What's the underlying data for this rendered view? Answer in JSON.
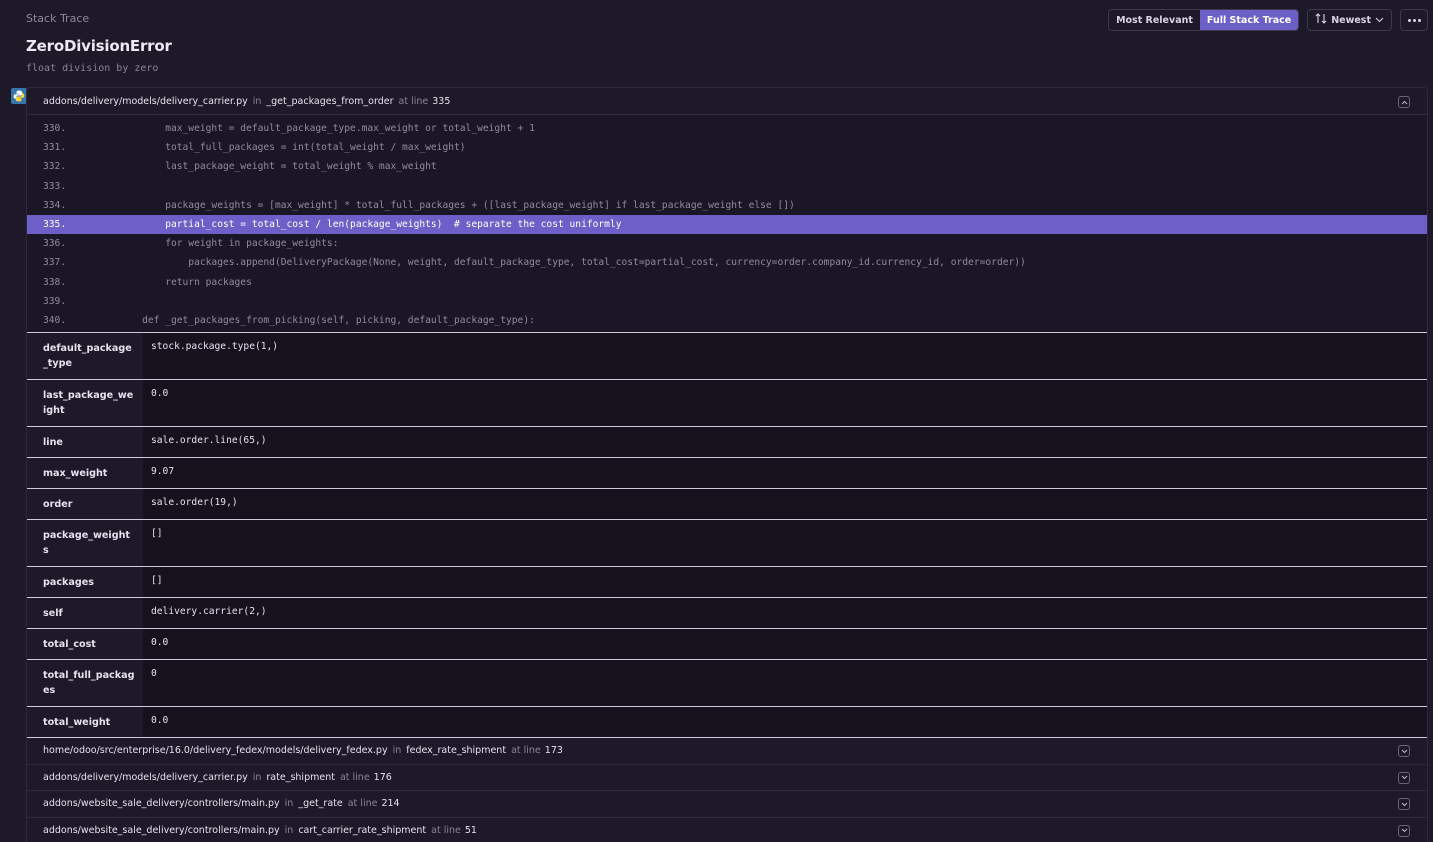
{
  "header": {
    "section_label": "Stack Trace",
    "exception_type": "ZeroDivisionError",
    "exception_message": "float division by zero"
  },
  "controls": {
    "most_relevant": "Most Relevant",
    "full_stack_trace": "Full Stack Trace",
    "sort_label": "Newest",
    "active_view": "Full Stack Trace"
  },
  "platform_icon": "python-icon",
  "expanded_frame": {
    "file": "addons/delivery/models/delivery_carrier.py",
    "in_word": "in",
    "function": "_get_packages_from_order",
    "at_line_word": "at line",
    "line": "335",
    "code": [
      {
        "num": "330.",
        "text": "        max_weight = default_package_type.max_weight or total_weight + 1"
      },
      {
        "num": "331.",
        "text": "        total_full_packages = int(total_weight / max_weight)"
      },
      {
        "num": "332.",
        "text": "        last_package_weight = total_weight % max_weight"
      },
      {
        "num": "333.",
        "text": ""
      },
      {
        "num": "334.",
        "text": "        package_weights = [max_weight] * total_full_packages + ([last_package_weight] if last_package_weight else [])"
      },
      {
        "num": "335.",
        "text": "        partial_cost = total_cost / len(package_weights)  # separate the cost uniformly"
      },
      {
        "num": "336.",
        "text": "        for weight in package_weights:"
      },
      {
        "num": "337.",
        "text": "            packages.append(DeliveryPackage(None, weight, default_package_type, total_cost=partial_cost, currency=order.company_id.currency_id, order=order))"
      },
      {
        "num": "338.",
        "text": "        return packages"
      },
      {
        "num": "339.",
        "text": ""
      },
      {
        "num": "340.",
        "text": "    def _get_packages_from_picking(self, picking, default_package_type):"
      }
    ],
    "variables": [
      {
        "key": "default_package_type",
        "value": "stock.package.type(1,)"
      },
      {
        "key": "last_package_weight",
        "value": "0.0"
      },
      {
        "key": "line",
        "value": "sale.order.line(65,)"
      },
      {
        "key": "max_weight",
        "value": "9.07"
      },
      {
        "key": "order",
        "value": "sale.order(19,)"
      },
      {
        "key": "package_weights",
        "value": "[]"
      },
      {
        "key": "packages",
        "value": "[]"
      },
      {
        "key": "self",
        "value": "delivery.carrier(2,)"
      },
      {
        "key": "total_cost",
        "value": "0.0"
      },
      {
        "key": "total_full_packages",
        "value": "0"
      },
      {
        "key": "total_weight",
        "value": "0.0"
      }
    ]
  },
  "collapsed_frames": [
    {
      "file": "home/odoo/src/enterprise/16.0/delivery_fedex/models/delivery_fedex.py",
      "in_word": "in",
      "function": "fedex_rate_shipment",
      "at_line_word": "at line",
      "line": "173"
    },
    {
      "file": "addons/delivery/models/delivery_carrier.py",
      "in_word": "in",
      "function": "rate_shipment",
      "at_line_word": "at line",
      "line": "176"
    },
    {
      "file": "addons/website_sale_delivery/controllers/main.py",
      "in_word": "in",
      "function": "_get_rate",
      "at_line_word": "at line",
      "line": "214"
    },
    {
      "file": "addons/website_sale_delivery/controllers/main.py",
      "in_word": "in",
      "function": "cart_carrier_rate_shipment",
      "at_line_word": "at line",
      "line": "51"
    }
  ],
  "colors": {
    "accent": "#6c5fc7",
    "background": "#1d1929",
    "code_background": "#1a1625"
  }
}
